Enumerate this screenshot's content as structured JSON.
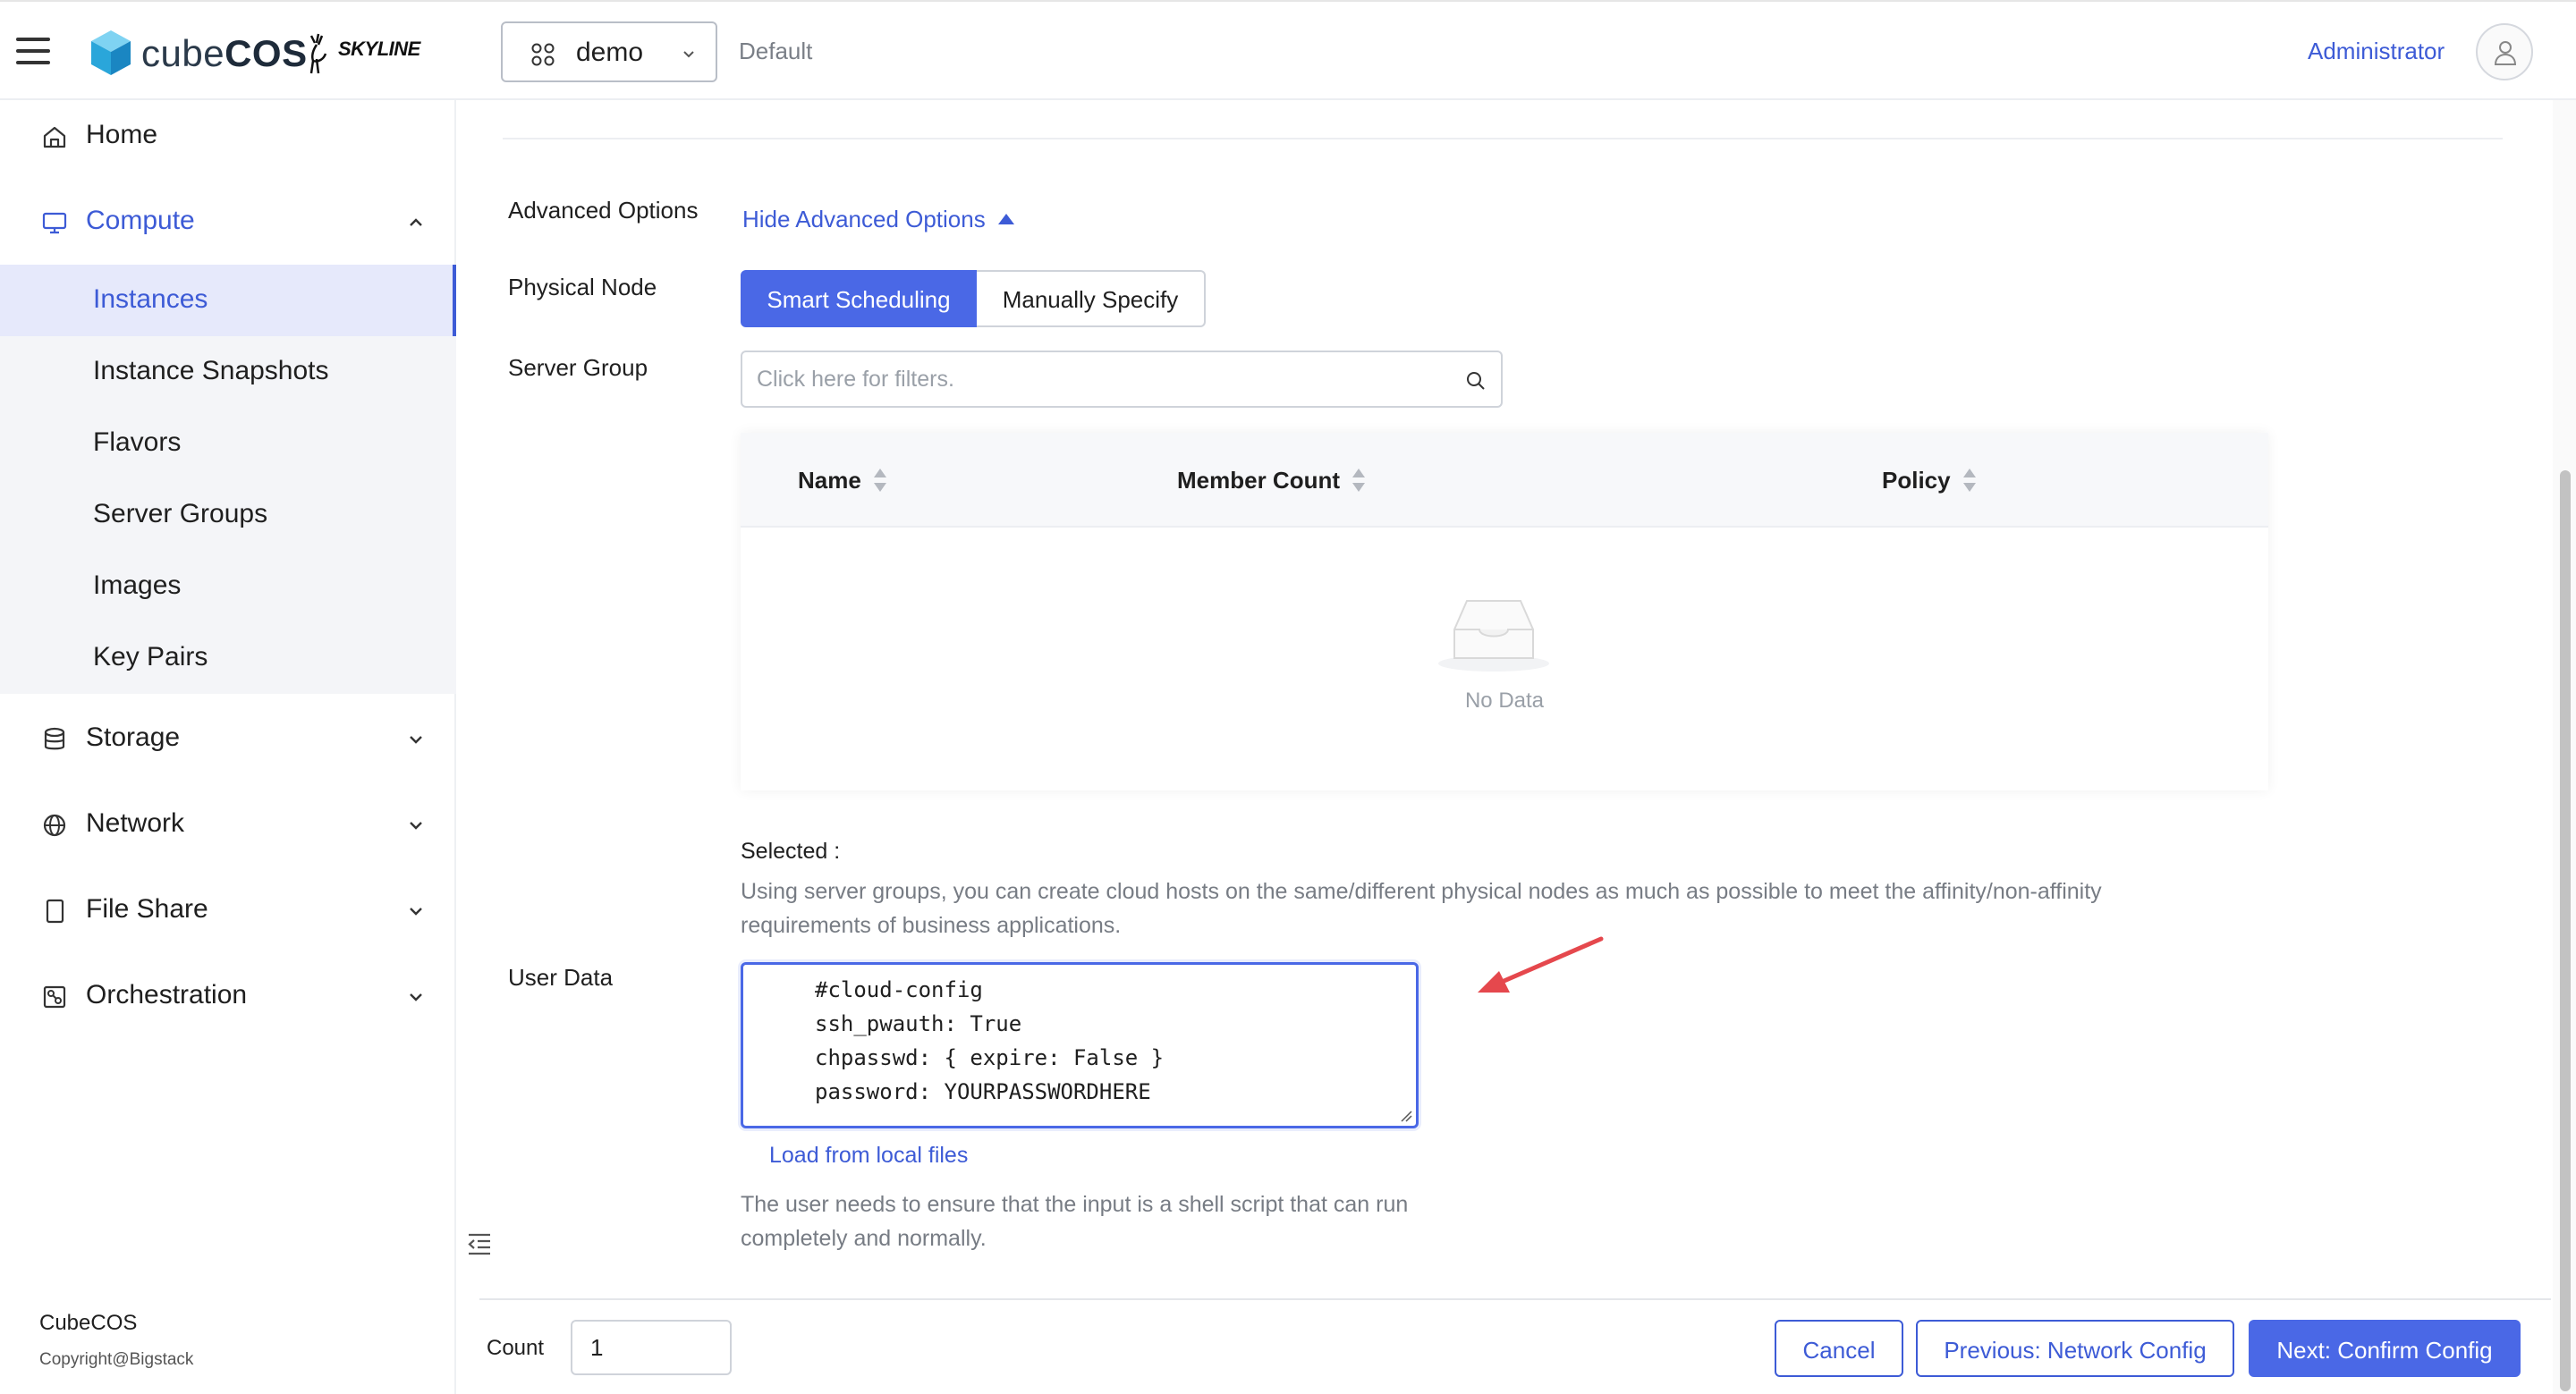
{
  "header": {
    "logo_prefix": "cube",
    "logo_suffix": "COS",
    "partner_logo": "SKYLINE",
    "project": "demo",
    "domain": "Default",
    "user": "Administrator"
  },
  "sidebar": {
    "items": [
      {
        "label": "Home",
        "icon": "home-icon"
      },
      {
        "label": "Compute",
        "icon": "monitor-icon"
      },
      {
        "label": "Storage",
        "icon": "database-icon"
      },
      {
        "label": "Network",
        "icon": "globe-icon"
      },
      {
        "label": "File Share",
        "icon": "tablet-icon"
      },
      {
        "label": "Orchestration",
        "icon": "orchestration-icon"
      }
    ],
    "compute_sub": [
      {
        "label": "Instances"
      },
      {
        "label": "Instance Snapshots"
      },
      {
        "label": "Flavors"
      },
      {
        "label": "Server Groups"
      },
      {
        "label": "Images"
      },
      {
        "label": "Key Pairs"
      }
    ],
    "footer_brand": "CubeCOS",
    "footer_copy": "Copyright@Bigstack"
  },
  "form": {
    "advanced_label": "Advanced Options",
    "advanced_toggle": "Hide Advanced Options",
    "physical_node_label": "Physical Node",
    "physical_node_options": [
      "Smart Scheduling",
      "Manually Specify"
    ],
    "server_group_label": "Server Group",
    "server_group_placeholder": "Click here for filters.",
    "table_columns": [
      "Name",
      "Member Count",
      "Policy"
    ],
    "empty_text": "No Data",
    "selected_label": "Selected :",
    "server_group_help": "Using server groups, you can create cloud hosts on the same/different physical nodes as much as possible to meet the affinity/non-affinity requirements of business applications.",
    "user_data_label": "User Data",
    "user_data_lines": [
      "#cloud-config",
      "ssh_pwauth: True",
      "chpasswd: { expire: False }",
      "password: YOURPASSWORDHERE"
    ],
    "load_link": "Load from local files",
    "user_data_help": "The user needs to ensure that the input is a shell script that can run completely and normally."
  },
  "footer": {
    "count_label": "Count",
    "count_value": "1",
    "cancel": "Cancel",
    "previous": "Previous: Network Config",
    "next": "Next: Confirm Config"
  },
  "colors": {
    "accent": "#4a68e6",
    "link": "#3d5bd6",
    "annotation_arrow": "#e5484d"
  }
}
